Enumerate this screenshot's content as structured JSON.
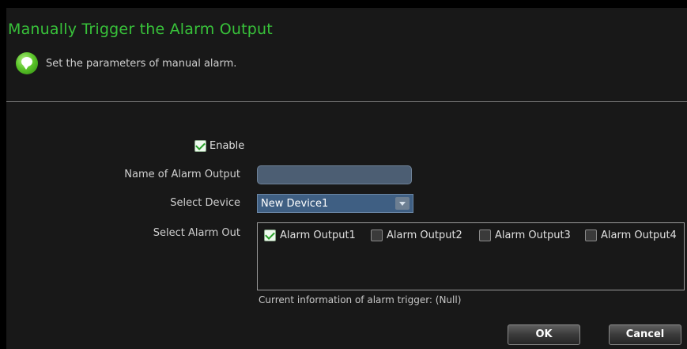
{
  "dialog": {
    "title": "Manually Trigger the Alarm Output",
    "subtitle": "Set the parameters of manual alarm.",
    "info_icon": "info-bubble-icon"
  },
  "form": {
    "enable": {
      "label": "Enable",
      "checked": true
    },
    "name_label": "Name of Alarm Output",
    "name_value": "",
    "device_label": "Select Device",
    "device_value": "New Device1",
    "alarm_out_label": "Select Alarm Out",
    "alarm_outputs": [
      {
        "label": "Alarm Output1",
        "checked": true
      },
      {
        "label": "Alarm Output2",
        "checked": false
      },
      {
        "label": "Alarm Output3",
        "checked": false
      },
      {
        "label": "Alarm Output4",
        "checked": false
      }
    ],
    "current_info": "Current information of alarm trigger: (Null)"
  },
  "buttons": {
    "ok": "OK",
    "cancel": "Cancel"
  },
  "colors": {
    "title": "#38c23a",
    "background": "#181818",
    "input": "#4c5e73",
    "select": "#3f5f83"
  }
}
